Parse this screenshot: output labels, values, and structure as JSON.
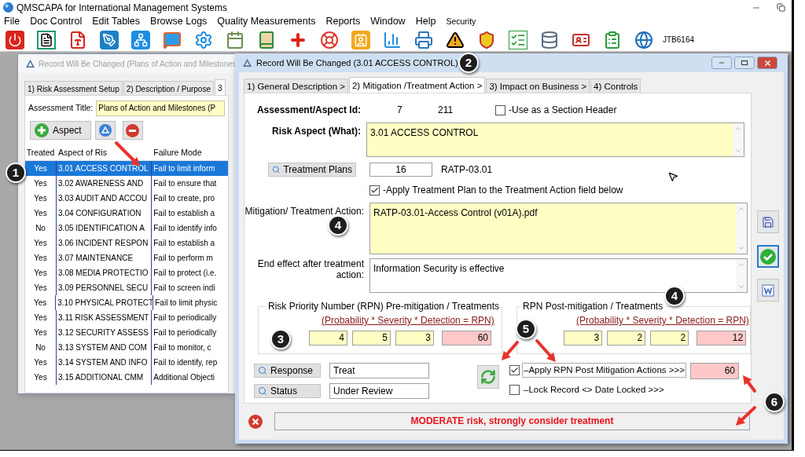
{
  "app": {
    "title": "QMSCAPA for International Management Systems"
  },
  "menu": [
    {
      "label": "File",
      "kind": "menu"
    },
    {
      "label": "Doc Control",
      "kind": "menu"
    },
    {
      "label": "Edit Tables",
      "kind": "menu"
    },
    {
      "label": "Browse Logs",
      "kind": "menu"
    },
    {
      "label": "Quality Measurements",
      "kind": "menu"
    },
    {
      "label": "Reports",
      "kind": "menu"
    },
    {
      "label": "Window",
      "kind": "menu"
    },
    {
      "label": "Help",
      "kind": "menu"
    },
    {
      "label": "Security",
      "kind": "small"
    }
  ],
  "toolbar": {
    "user": "JTB6164"
  },
  "back_window": {
    "title": "Record Will Be Changed (Plans of Action and Milestones",
    "active": false,
    "tabs": [
      {
        "label": "1) Risk Assessment Setup",
        "selected": false
      },
      {
        "label": "2) Description / Purpose",
        "selected": false
      },
      {
        "label": "3",
        "selected": true
      }
    ],
    "assessment_title": {
      "label": "Assessment Title:",
      "value": "Plans of Action and Milestones (P"
    },
    "add_button": "Aspect",
    "table": {
      "columns": [
        "Treated",
        "Aspect of Ris",
        "Failure Mode"
      ],
      "rows": [
        {
          "treated": "Yes",
          "aspect": "3.01 ACCESS CONTROL",
          "failure_mode": "Fail to limit inform",
          "selected": true
        },
        {
          "treated": "Yes",
          "aspect": "3.02 AWARENESS AND",
          "failure_mode": "Fail to ensure that",
          "selected": false
        },
        {
          "treated": "Yes",
          "aspect": "3.03 AUDIT AND ACCOU",
          "failure_mode": "Fail to create, pro",
          "selected": false
        },
        {
          "treated": "Yes",
          "aspect": "3.04 CONFIGURATION",
          "failure_mode": "Fail to establish a",
          "selected": false
        },
        {
          "treated": "No",
          "aspect": "3.05 IDENTIFICATION A",
          "failure_mode": "Fail to identify info",
          "selected": false
        },
        {
          "treated": "Yes",
          "aspect": "3.06 INCIDENT RESPON",
          "failure_mode": "Fail to establish a",
          "selected": false
        },
        {
          "treated": "Yes",
          "aspect": "3.07 MAINTENANCE",
          "failure_mode": "Fail to perform m",
          "selected": false
        },
        {
          "treated": "Yes",
          "aspect": "3.08 MEDIA PROTECTIO",
          "failure_mode": "Fail to protect (i.e.",
          "selected": false
        },
        {
          "treated": "Yes",
          "aspect": "3.09 PERSONNEL SECU",
          "failure_mode": "Fail to screen indi",
          "selected": false
        },
        {
          "treated": "Yes",
          "aspect": "3.10 PHYSICAL PROTECT",
          "failure_mode": "Fail to limit physic",
          "selected": false
        },
        {
          "treated": "Yes",
          "aspect": "3.11 RISK ASSESSMENT",
          "failure_mode": "Fail to periodically",
          "selected": false
        },
        {
          "treated": "Yes",
          "aspect": "3.12 SECURITY ASSESS",
          "failure_mode": "Fail to periodically",
          "selected": false
        },
        {
          "treated": "No",
          "aspect": "3.13 SYSTEM AND COM",
          "failure_mode": "Fail to monitor, c",
          "selected": false
        },
        {
          "treated": "Yes",
          "aspect": "3.14 SYSTEM AND INFO",
          "failure_mode": "Fail to identify, rep",
          "selected": false
        },
        {
          "treated": "Yes",
          "aspect": "3.15 ADDITIONAL CMM",
          "failure_mode": "Additional Objecti",
          "selected": false
        }
      ]
    }
  },
  "front_window": {
    "title": "Record Will Be Changed (3.01 ACCESS CONTROL)",
    "active": true,
    "tabs": [
      {
        "label": "1) General Description >",
        "selected": false
      },
      {
        "label": "2) Mitigation /Treatment Action >",
        "selected": true
      },
      {
        "label": "3) Impact on Business >",
        "selected": false
      },
      {
        "label": "4) Controls",
        "selected": false
      }
    ],
    "id_label": "Assessment/Aspect Id:",
    "ids": [
      "7",
      "211"
    ],
    "section_header": {
      "label": "-Use as a Section Header",
      "checked": false
    },
    "risk_aspect": {
      "label": "Risk Aspect (What):",
      "value": "3.01 ACCESS CONTROL"
    },
    "treatment_plans": {
      "button": "Treatment Plans",
      "value": "16",
      "code": "RATP-03.01"
    },
    "apply_plan": {
      "label": "-Apply Treatment Plan to the Treatment Action field below",
      "checked": true
    },
    "mitigation": {
      "label": "Mitigation/ Treatment Action:",
      "value": "RATP-03.01-Access Control (v01A).pdf"
    },
    "end_effect": {
      "label": "End effect after treatment action:",
      "value": "Information Security is effective"
    },
    "rpn_groups": [
      {
        "title": "Risk Priority Number (RPN) Pre-mitigation / Treatments",
        "formula": "(Probability * Severity * Detection = RPN)",
        "factors": [
          "4",
          "5",
          "3"
        ],
        "result": "60"
      },
      {
        "title": "RPN Post-mitigation / Treatments",
        "formula": "(Probability * Severity * Detection = RPN)",
        "factors": [
          "3",
          "2",
          "2"
        ],
        "result": "12"
      }
    ],
    "lookups": [
      {
        "button": "Response",
        "value": "Treat"
      },
      {
        "button": "Status",
        "value": "Under Review"
      }
    ],
    "apply_rpn": {
      "label": "–Apply RPN Post Mitigation Actions >>>",
      "checked": true,
      "focused": true
    },
    "applied_rpn": "60",
    "lock_record": {
      "label": "–Lock Record <> Date Locked >>>",
      "checked": false
    },
    "side_buttons": [
      {
        "kind": "save",
        "selected": false
      },
      {
        "kind": "accept",
        "selected": true
      },
      {
        "kind": "word",
        "selected": false
      }
    ],
    "message": "MODERATE risk, strongly consider treatment"
  },
  "annotations": [
    "1",
    "2",
    "3",
    "4",
    "4",
    "5",
    "6"
  ]
}
